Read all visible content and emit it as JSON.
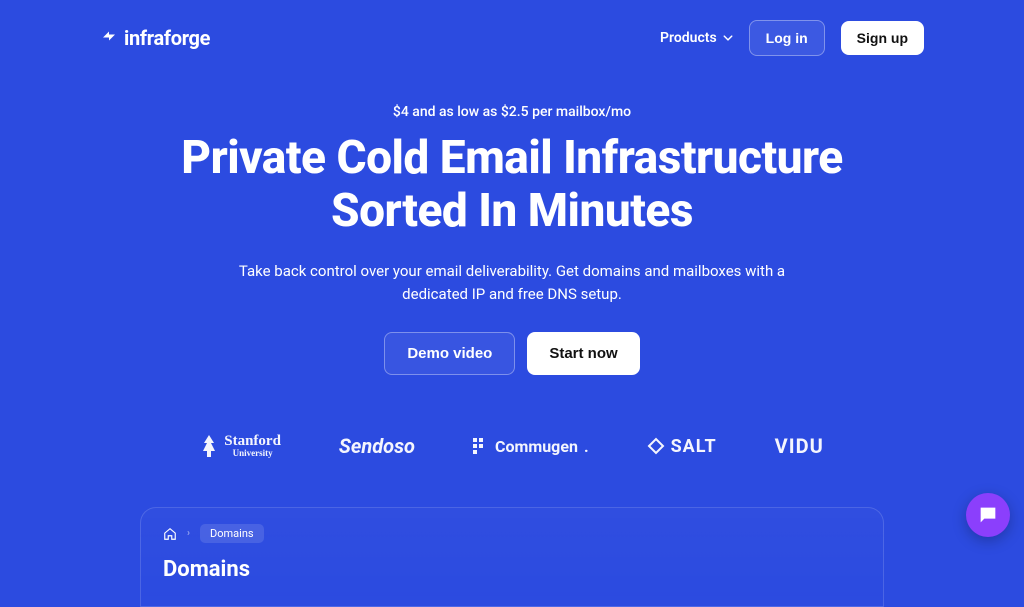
{
  "header": {
    "brand": "infraforge",
    "products_label": "Products",
    "login_label": "Log in",
    "signup_label": "Sign up"
  },
  "hero": {
    "pricing": "$4 and as low as $2.5 per mailbox/mo",
    "title_line1": "Private Cold Email Infrastructure",
    "title_line2": "Sorted In Minutes",
    "subtitle": "Take back control over your email deliverability. Get domains and mailboxes with a dedicated IP and free DNS setup.",
    "demo_label": "Demo video",
    "start_label": "Start now"
  },
  "clients": {
    "stanford_top": "Stanford",
    "stanford_bottom": "University",
    "sendoso": "Sendoso",
    "commugen": "Commugen",
    "salt": "SALT",
    "vidu": "VIDU"
  },
  "panel": {
    "breadcrumb_current": "Domains",
    "title": "Domains"
  }
}
